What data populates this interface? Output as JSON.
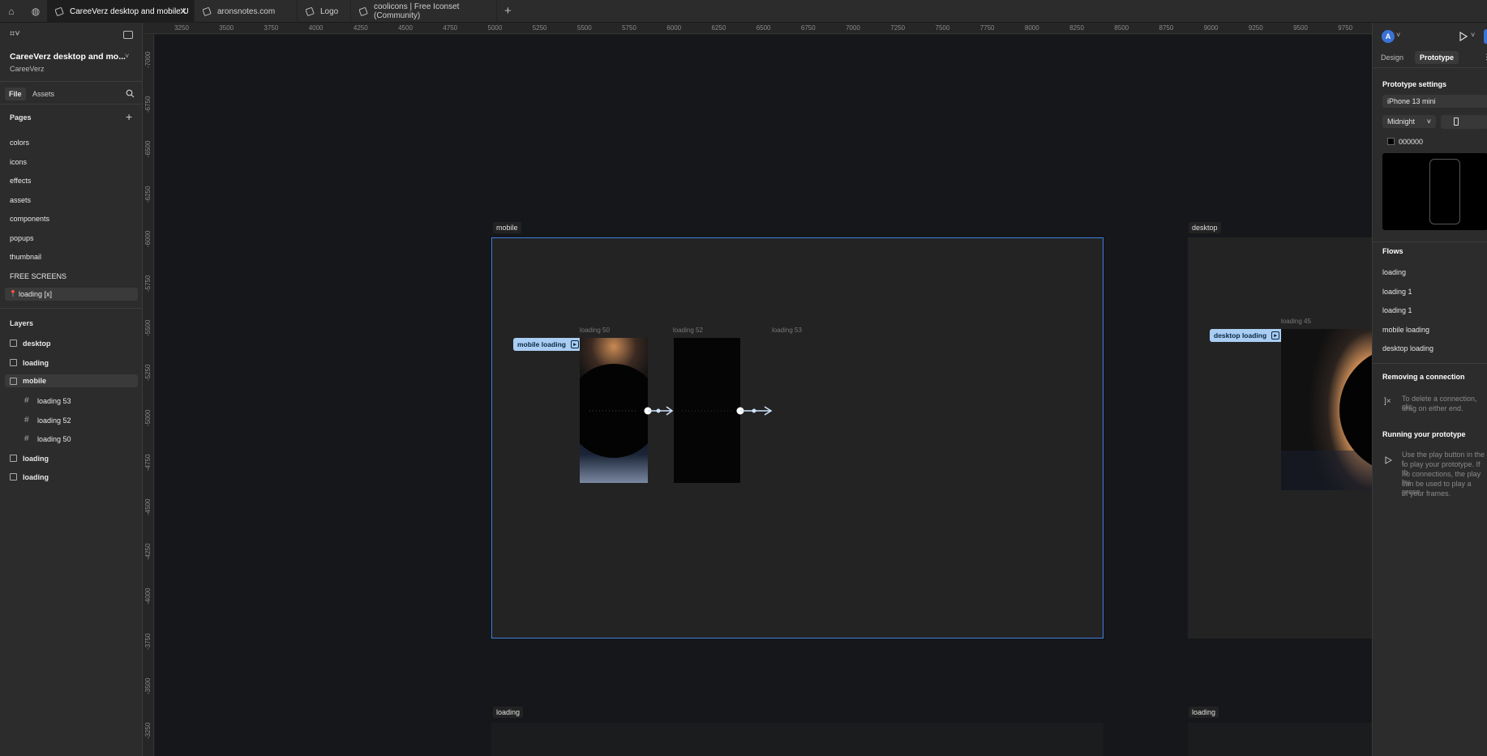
{
  "tabs": [
    {
      "label": "CareeVerz desktop and mobile U",
      "active": true
    },
    {
      "label": "aronsnotes.com",
      "active": false
    },
    {
      "label": "Logo",
      "active": false
    },
    {
      "label": "coolicons | Free Iconset (Community)",
      "active": false
    }
  ],
  "file": {
    "title": "CareeVerz desktop and mo...",
    "team": "CareeVerz"
  },
  "left_tabs": {
    "file": "File",
    "assets": "Assets"
  },
  "pages": {
    "heading": "Pages",
    "items": [
      "colors",
      "icons",
      "effects",
      "assets",
      "components",
      "popups",
      "thumbnail",
      "FREE SCREENS",
      "loading [x]"
    ],
    "selected_item": "loading [x]"
  },
  "layers": {
    "heading": "Layers",
    "items": [
      {
        "label": "desktop",
        "type": "frame",
        "indent": 0
      },
      {
        "label": "loading",
        "type": "frame",
        "indent": 0
      },
      {
        "label": "mobile",
        "type": "frame",
        "indent": 0,
        "selected": true
      },
      {
        "label": "loading 53",
        "type": "grid",
        "indent": 1
      },
      {
        "label": "loading 52",
        "type": "grid",
        "indent": 1
      },
      {
        "label": "loading 50",
        "type": "grid",
        "indent": 1
      },
      {
        "label": "loading",
        "type": "frame",
        "indent": 0
      },
      {
        "label": "loading",
        "type": "frame",
        "indent": 0
      }
    ]
  },
  "ruler_top": [
    "3250",
    "3500",
    "3750",
    "4000",
    "4250",
    "4500",
    "4750",
    "5000",
    "5250",
    "5500",
    "5750",
    "6000",
    "6250",
    "6500",
    "6750",
    "7000",
    "7250",
    "7500",
    "7750",
    "8000",
    "8250",
    "8500",
    "8750",
    "9000",
    "9250",
    "9500",
    "9750"
  ],
  "ruler_left": [
    "-7000",
    "-6750",
    "-6500",
    "-6250",
    "-6000",
    "-5750",
    "-5500",
    "-5250",
    "-5000",
    "-4750",
    "-4500",
    "-4250",
    "-4000",
    "-3750",
    "-3500",
    "-3250"
  ],
  "canvas": {
    "frame_mobile": "mobile",
    "frame_desktop": "desktop",
    "frame_loading_1": "loading",
    "frame_loading_2": "loading",
    "label_l50": "loading 50",
    "label_l52": "loading 52",
    "label_l53": "loading 53",
    "label_l45": "loading 45",
    "flow_mobile": "mobile loading",
    "flow_desktop": "desktop loading"
  },
  "right": {
    "avatar": "A",
    "tab_design": "Design",
    "tab_prototype": "Prototype",
    "proto_settings": "Prototype settings",
    "device": "iPhone 13 mini",
    "model": "Midnight",
    "bg_hex": "000000",
    "flows_heading": "Flows",
    "flows": [
      "loading",
      "loading 1",
      "loading 1",
      "mobile loading",
      "desktop loading"
    ],
    "remove_heading": "Removing a connection",
    "remove_text": [
      "To delete a connection, clic",
      "drag on either end."
    ],
    "running_heading": "Running your prototype",
    "running_text": [
      "Use the play button in the t",
      "to play your prototype. If th",
      "no connections, the play bu",
      "can be used to play a prese",
      "of your frames."
    ]
  },
  "colors": {
    "accent": "#3d7ee0",
    "flow_chip": "#a9cdf3"
  }
}
